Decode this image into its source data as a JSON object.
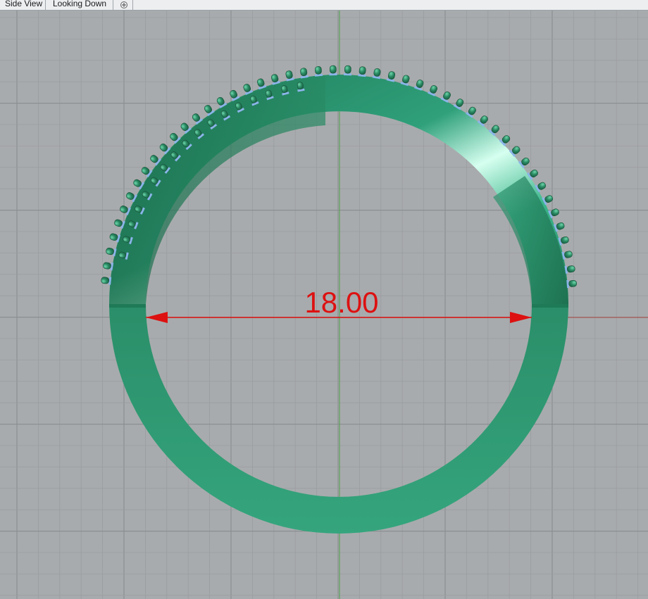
{
  "tabs": [
    {
      "label": "Side View"
    },
    {
      "label": "Looking Down"
    }
  ],
  "add_tab_icon": "plus-icon",
  "viewport": {
    "background_color": "#a8abad",
    "grid_color": "#9a9da0",
    "axis_x_color": "#b04848",
    "axis_y_color": "#4aa04a"
  },
  "model": {
    "name": "ring",
    "band_color": "#2e9c74",
    "stone_color": "#2a8a63",
    "prong_highlight_color": "#8ab4e8"
  },
  "dimension": {
    "value_text": "18.00",
    "color": "#dd1111"
  }
}
